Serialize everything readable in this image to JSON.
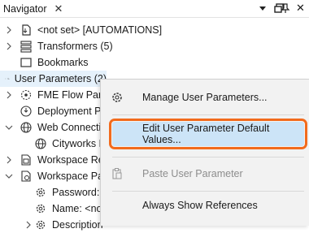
{
  "panel": {
    "title": "Navigator",
    "close_glyph": "✕"
  },
  "tree": {
    "items": [
      {
        "label": "<not set> [AUTOMATIONS]",
        "icon": "workspace-file-icon"
      },
      {
        "label": "Transformers (5)",
        "icon": "transformers-stack-icon"
      },
      {
        "label": "Bookmarks",
        "icon": "bookmark-icon"
      },
      {
        "label": "User Parameters (2)",
        "icon": "user-parameters-icon"
      },
      {
        "label": "FME Flow Parameters",
        "icon": "flow-parameters-icon"
      },
      {
        "label": "Deployment Parameters",
        "icon": "deployment-parameters-icon"
      },
      {
        "label": "Web Connections",
        "icon": "globe-icon"
      },
      {
        "label": "Cityworks D",
        "icon": "globe-icon"
      },
      {
        "label": "Workspace Resources",
        "icon": "workspace-resources-icon"
      },
      {
        "label": "Workspace Parameters",
        "icon": "workspace-parameters-icon"
      },
      {
        "label": "Password: <not set>",
        "icon": "gear-icon"
      },
      {
        "label": "Name: <not set>",
        "icon": "gear-icon"
      },
      {
        "label": "Description",
        "icon": "gear-icon"
      }
    ]
  },
  "context_menu": {
    "items": [
      {
        "label": "Manage User Parameters...",
        "icon": "gear-icon",
        "enabled": true
      },
      {
        "label": "Edit User Parameter Default Values...",
        "icon": "",
        "enabled": true,
        "highlighted": true
      },
      {
        "label": "Paste User Parameter",
        "icon": "paste-icon",
        "enabled": false
      },
      {
        "label": "Always Show References",
        "icon": "",
        "enabled": true
      }
    ]
  },
  "colors": {
    "highlight_bg": "#cce4f7",
    "highlight_outline": "#f26b1d",
    "menu_bg": "#f2f2f2",
    "selection_bg": "#e5f1fb"
  }
}
